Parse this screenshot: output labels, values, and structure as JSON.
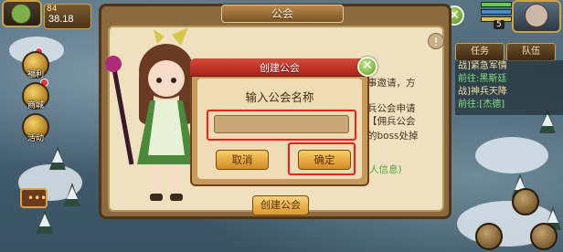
{
  "hud": {
    "level": "84",
    "power": "38.18",
    "right_level": "5"
  },
  "side_menu": [
    {
      "label": "福利",
      "icon": "gift-icon"
    },
    {
      "label": "商城",
      "icon": "shop-icon"
    },
    {
      "label": "活动",
      "icon": "activity-icon"
    }
  ],
  "quest": {
    "tabs": [
      "任务",
      "队伍"
    ],
    "lines": [
      "战]紧急军情",
      "前往:黑斯廷",
      "战]神兵天降",
      "前往:[杰德]"
    ]
  },
  "guild_panel": {
    "title": "公会",
    "text_lines": [
      "事邀请，方",
      "兵公会申请",
      "【佣兵公会",
      "的boss处掉"
    ],
    "green_text": "人信息)",
    "create_button": "创建公会"
  },
  "modal": {
    "title": "创建公会",
    "prompt": "输入公会名称",
    "input_value": "",
    "cancel_label": "取消",
    "confirm_label": "确定"
  },
  "colors": {
    "ribbon": "#c8342a",
    "button": "#e9ad45",
    "annotation": "#ff1a1a"
  }
}
